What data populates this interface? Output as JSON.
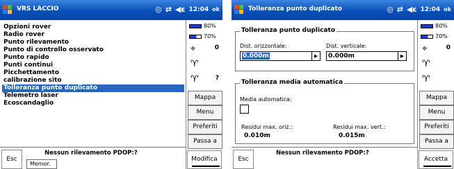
{
  "left_screen": {
    "title": "VRS LACCIO",
    "status": {
      "time": "12:04",
      "ok_label": "ok"
    },
    "menu": [
      "Opzioni rover",
      "Radio rover",
      "Punto rilevamento",
      "Punto di controllo osservato",
      "Punto rapido",
      "Punti continui",
      "Picchettamento",
      "calibrazione sito",
      "Tolleranza punto duplicato",
      "Telemetro laser",
      "Ecoscandaglio"
    ],
    "selected_index": 8,
    "sidebar": {
      "battery1": "80%",
      "battery2": "70%",
      "sat_count": "0",
      "question": "?",
      "buttons": [
        "Mappa",
        "Menu",
        "Preferiti",
        "Passa a"
      ]
    },
    "bottom": {
      "esc": "Esc",
      "message": "Nessun rilevamento PDOP:?",
      "memor": "Memor.",
      "action": "Modifica"
    }
  },
  "right_screen": {
    "title": "Tolleranza punto duplicato",
    "status": {
      "time": "12:04",
      "ok_label": "ok"
    },
    "group1": {
      "title": "Tolleranza punto duplicato",
      "horiz_label": "Dist. orizzontale:",
      "horiz_value": "0.000m",
      "vert_label": "Dist. verticale:",
      "vert_value": "0.000m"
    },
    "group2": {
      "title": "Tolleranza media automatica",
      "media_label": "Media automatica:",
      "res_oriz_label": "Residui max. oriz.:",
      "res_oriz_value": "0.010m",
      "res_vert_label": "Residui max. vert.:",
      "res_vert_value": "0.015m"
    },
    "sidebar": {
      "battery1": "80%",
      "battery2": "70%",
      "sat_count": "0",
      "buttons": [
        "Mappa",
        "Menu",
        "Preferiti",
        "Passa a"
      ]
    },
    "bottom": {
      "esc": "Esc",
      "message": "Nessun rilevamento PDOP:?",
      "action": "Accetta"
    }
  },
  "colors": {
    "title_bar": "#0a4fb8",
    "selection": "#2366c8"
  }
}
